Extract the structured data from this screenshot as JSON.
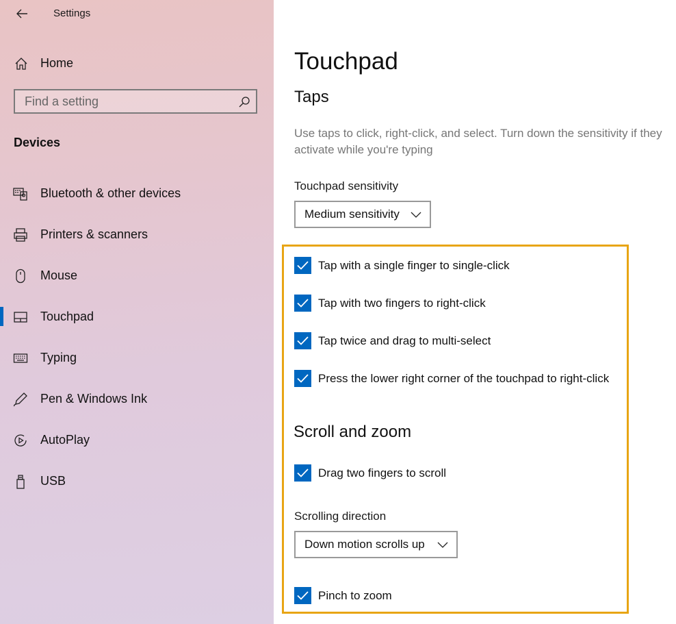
{
  "app": {
    "title": "Settings"
  },
  "sidebar": {
    "home_label": "Home",
    "search_placeholder": "Find a setting",
    "section_title": "Devices",
    "items": [
      {
        "label": "Bluetooth & other devices",
        "icon": "bluetooth-devices-icon",
        "selected": false
      },
      {
        "label": "Printers & scanners",
        "icon": "printer-icon",
        "selected": false
      },
      {
        "label": "Mouse",
        "icon": "mouse-icon",
        "selected": false
      },
      {
        "label": "Touchpad",
        "icon": "touchpad-icon",
        "selected": true
      },
      {
        "label": "Typing",
        "icon": "keyboard-icon",
        "selected": false
      },
      {
        "label": "Pen & Windows Ink",
        "icon": "pen-icon",
        "selected": false
      },
      {
        "label": "AutoPlay",
        "icon": "autoplay-icon",
        "selected": false
      },
      {
        "label": "USB",
        "icon": "usb-icon",
        "selected": false
      }
    ]
  },
  "main": {
    "title": "Touchpad",
    "taps": {
      "heading": "Taps",
      "description": "Use taps to click, right-click, and select. Turn down the sensitivity if they activate while you're typing",
      "sensitivity_label": "Touchpad sensitivity",
      "sensitivity_value": "Medium sensitivity",
      "checkboxes": [
        {
          "label": "Tap with a single finger to single-click",
          "checked": true
        },
        {
          "label": "Tap with two fingers to right-click",
          "checked": true
        },
        {
          "label": "Tap twice and drag to multi-select",
          "checked": true
        },
        {
          "label": "Press the lower right corner of the touchpad to right-click",
          "checked": true
        }
      ]
    },
    "scroll_zoom": {
      "heading": "Scroll and zoom",
      "drag_scroll_label": "Drag two fingers to scroll",
      "drag_scroll_checked": true,
      "direction_label": "Scrolling direction",
      "direction_value": "Down motion scrolls up",
      "pinch_label": "Pinch to zoom",
      "pinch_checked": true
    }
  },
  "colors": {
    "accent": "#0067c0",
    "highlight_border": "#e8a514"
  }
}
